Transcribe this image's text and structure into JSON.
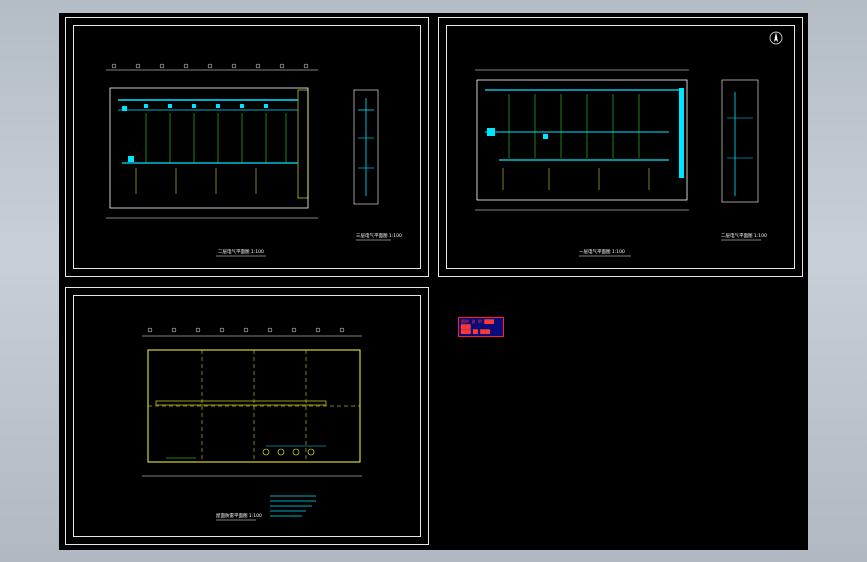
{
  "app": {
    "title": ""
  },
  "drawing": {
    "sheets": [
      {
        "name": "sheet-top-left",
        "title_main": "二层电气平面图 1:100",
        "title_side": "三层电气平面图 1:100"
      },
      {
        "name": "sheet-top-right",
        "title_main": "一层电气平面图 1:100",
        "title_side": "二层电气平面图 1:100"
      },
      {
        "name": "sheet-bottom",
        "title_main": "屋面防雷平面图 1:100"
      }
    ],
    "north_arrow_icon": "north-arrow-icon",
    "legend_stamp": {
      "lines": [
        "图例 说 明 ████",
        "████",
        "████ ██ ████"
      ]
    }
  },
  "colors": {
    "background": "#000000",
    "frame": "#e8e8e8",
    "cyan": "#00e5ff",
    "yellow": "#ffff33",
    "green": "#33ff33",
    "magenta": "#ff33ff",
    "white": "#ffffff",
    "stamp_fill": "#0a0a78",
    "stamp_border": "#ff2222"
  }
}
